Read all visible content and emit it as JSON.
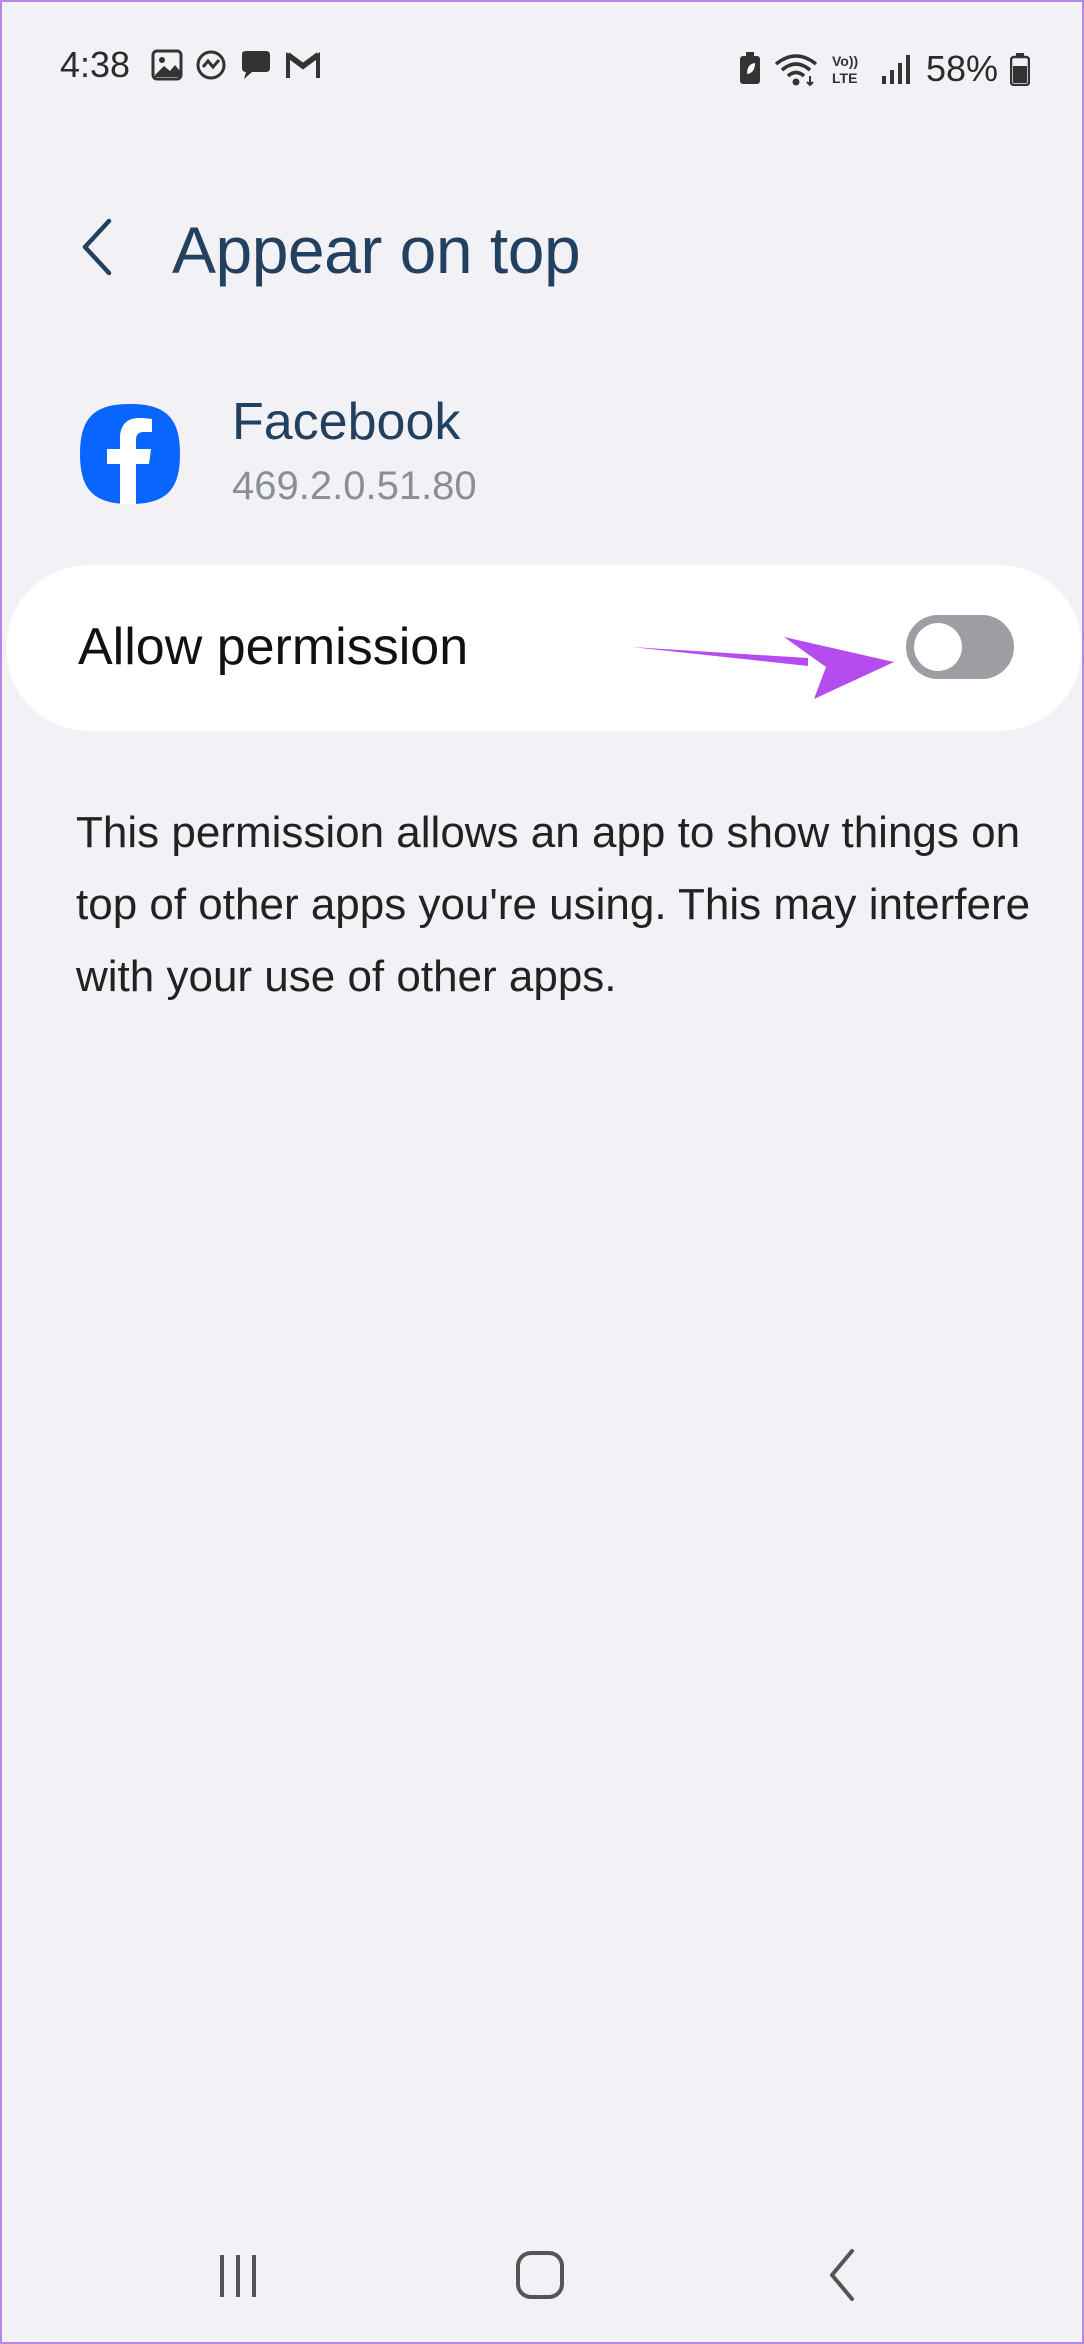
{
  "status_bar": {
    "time": "4:38",
    "battery_text": "58%",
    "left_icons": [
      "gallery-icon",
      "sync-icon",
      "chat-icon",
      "gmail-icon"
    ],
    "right_icons": [
      "battery-saver-icon",
      "wifi-icon",
      "volte-icon",
      "signal-icon",
      "battery-icon"
    ],
    "volte_text": "Vo)) LTE"
  },
  "header": {
    "title": "Appear on top"
  },
  "app": {
    "name": "Facebook",
    "version": "469.2.0.51.80",
    "icon": "facebook-icon",
    "brand_color": "#0866ff"
  },
  "permission": {
    "label": "Allow permission",
    "enabled": false,
    "annotation_color": "#b44cf0"
  },
  "description": "This permission allows an app to show things on top of other apps you're using. This may interfere with your use of other apps.",
  "nav_bar": {
    "buttons": [
      "recents-icon",
      "home-icon",
      "back-icon"
    ]
  }
}
